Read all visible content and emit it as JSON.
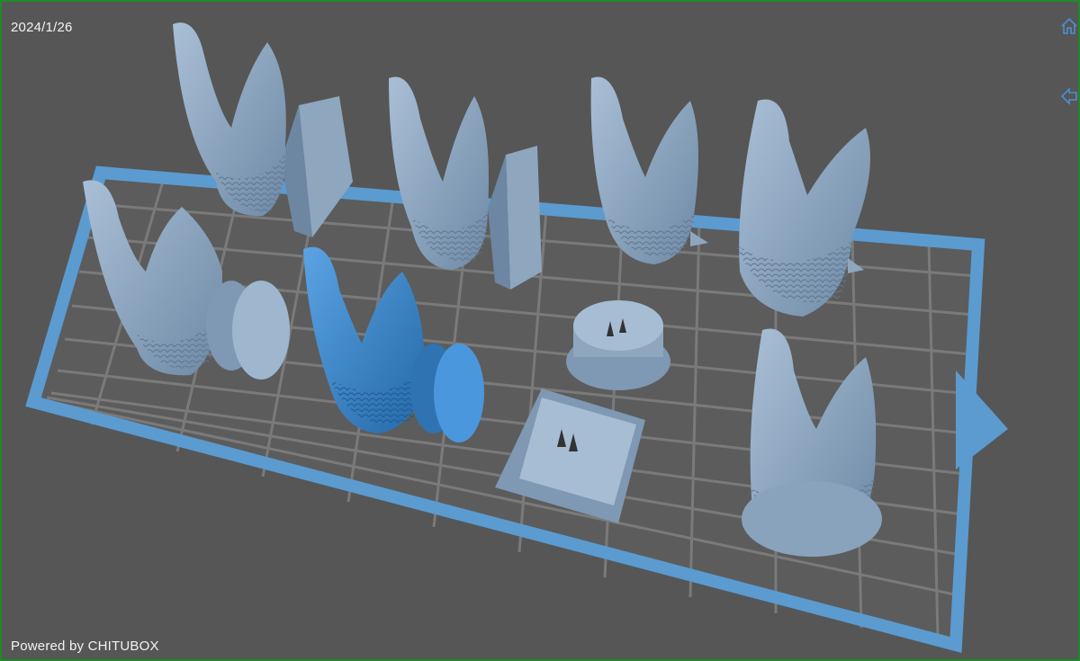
{
  "viewport": {
    "date": "2024/1/26",
    "powered_by": "Powered by CHITUBOX"
  },
  "icons": {
    "home": "home-icon",
    "back": "arrow-left-icon"
  },
  "colors": {
    "background": "#565656",
    "plate_frame": "#5b9bd0",
    "grid": "#7a7a7a",
    "model": "#8fa9c4",
    "model_selected": "#3d86c9",
    "window_border": "#1f8a2a"
  }
}
